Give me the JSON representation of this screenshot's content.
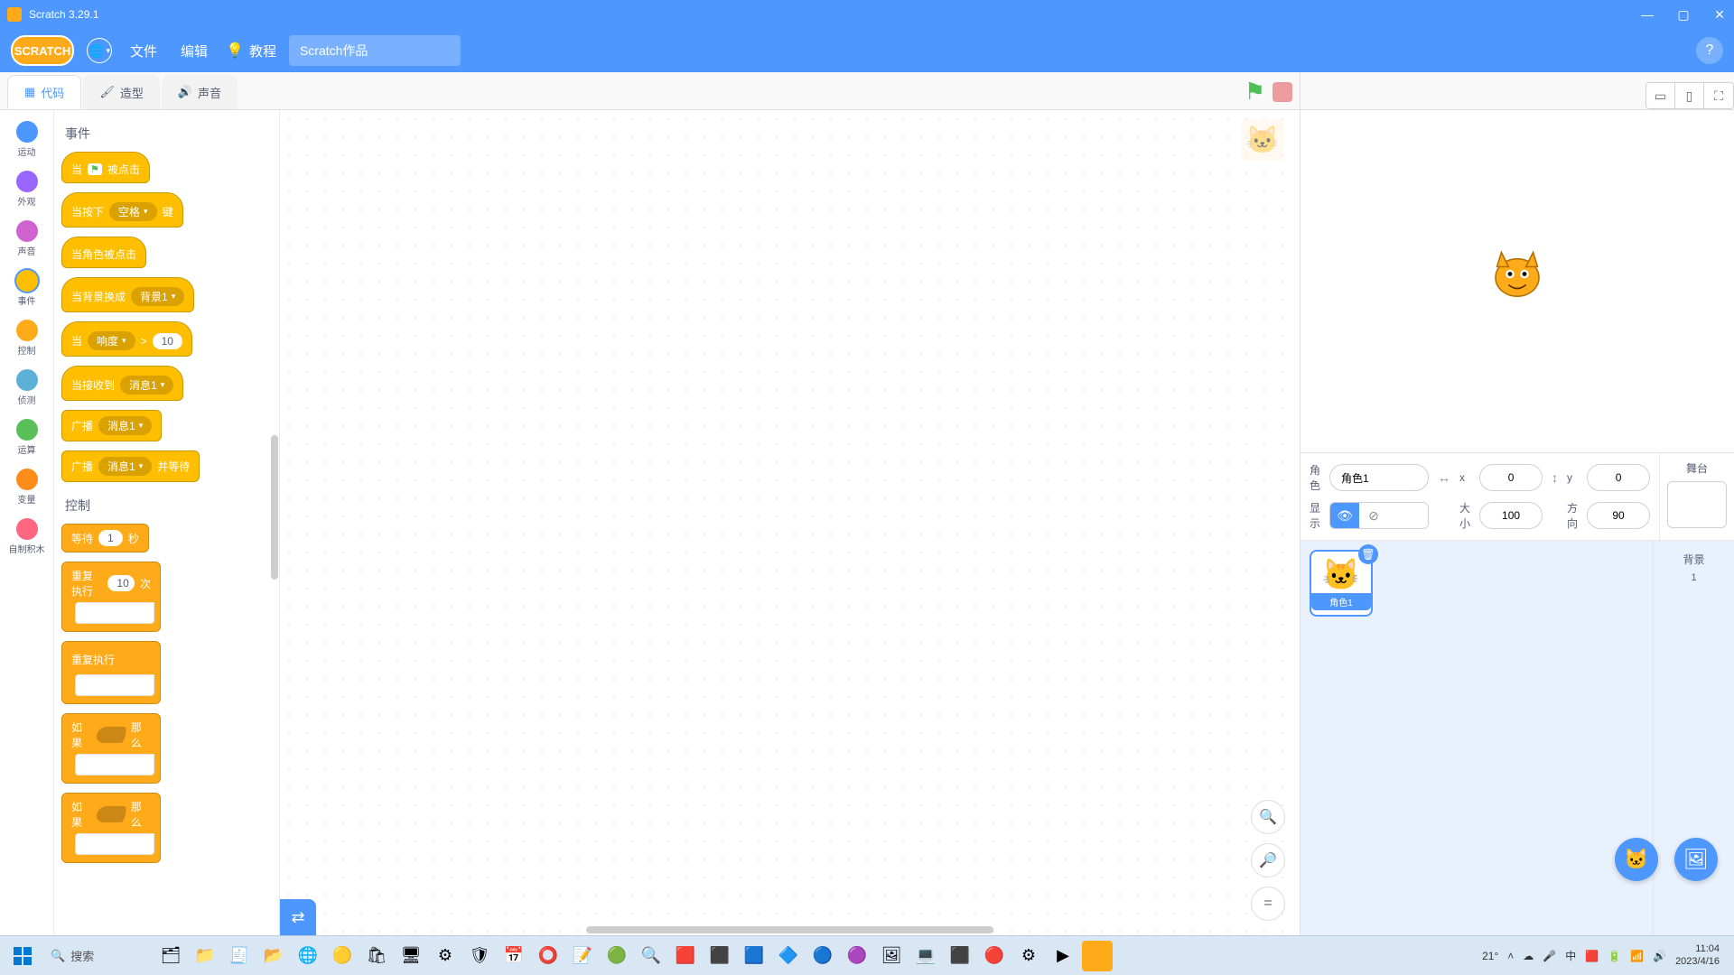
{
  "window": {
    "title": "Scratch 3.29.1"
  },
  "menu": {
    "file": "文件",
    "edit": "编辑",
    "tutorials": "教程",
    "project_name_value": "Scratch作品"
  },
  "tabs": {
    "code": "代码",
    "costumes": "造型",
    "sounds": "声音"
  },
  "categories": [
    {
      "id": "motion",
      "label": "运动",
      "color": "#4c97ff"
    },
    {
      "id": "looks",
      "label": "外观",
      "color": "#9966ff"
    },
    {
      "id": "sound",
      "label": "声音",
      "color": "#cf63cf"
    },
    {
      "id": "events",
      "label": "事件",
      "color": "#ffbf00"
    },
    {
      "id": "control",
      "label": "控制",
      "color": "#ffab19"
    },
    {
      "id": "sensing",
      "label": "侦测",
      "color": "#5cb1d6"
    },
    {
      "id": "operators",
      "label": "运算",
      "color": "#59c059"
    },
    {
      "id": "variables",
      "label": "变量",
      "color": "#ff8c1a"
    },
    {
      "id": "myblocks",
      "label": "自制积木",
      "color": "#ff6680"
    }
  ],
  "palette": {
    "events_heading": "事件",
    "control_heading": "控制",
    "blk_when_flag_a": "当",
    "blk_when_flag_b": "被点击",
    "blk_when_key_a": "当按下",
    "blk_when_key_dd": "空格",
    "blk_when_key_b": "键",
    "blk_when_sprite_clicked": "当角色被点击",
    "blk_when_backdrop_a": "当背景换成",
    "blk_when_backdrop_dd": "背景1",
    "blk_when_gt_a": "当",
    "blk_when_gt_dd": "响度",
    "blk_when_gt_op": ">",
    "blk_when_gt_val": "10",
    "blk_when_receive_a": "当接收到",
    "blk_when_receive_dd": "消息1",
    "blk_broadcast_a": "广播",
    "blk_broadcast_dd": "消息1",
    "blk_broadcast_wait_a": "广播",
    "blk_broadcast_wait_dd": "消息1",
    "blk_broadcast_wait_b": "并等待",
    "blk_wait_a": "等待",
    "blk_wait_val": "1",
    "blk_wait_b": "秒",
    "blk_repeat_a": "重复执行",
    "blk_repeat_val": "10",
    "blk_repeat_b": "次",
    "blk_forever": "重复执行",
    "blk_if_a": "如果",
    "blk_if_b": "那么",
    "blk_ifelse_a": "如果",
    "blk_ifelse_b": "那么"
  },
  "sprite_info": {
    "sprite_label": "角色",
    "sprite_name": "角色1",
    "x_label": "x",
    "x_value": "0",
    "y_label": "y",
    "y_value": "0",
    "show_label": "显示",
    "size_label": "大小",
    "size_value": "100",
    "direction_label": "方向",
    "direction_value": "90"
  },
  "stage_panel": {
    "stage_label": "舞台",
    "backdrops_label": "背景",
    "backdrops_count": "1"
  },
  "sprite_tile": {
    "name": "角色1"
  },
  "taskbar": {
    "search_placeholder": "搜索",
    "weather": "21°",
    "ime": "中",
    "time": "11:04",
    "date": "2023/4/16"
  }
}
